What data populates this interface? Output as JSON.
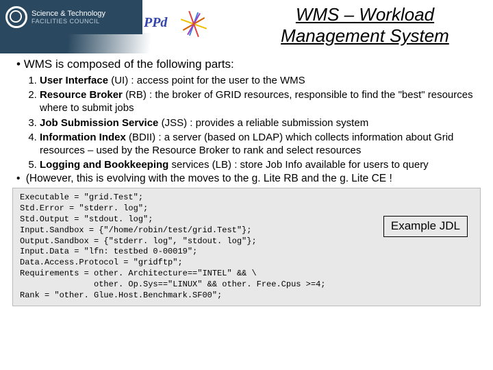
{
  "logo": {
    "line1": "Science & Technology",
    "line2": "FACILITIES COUNCIL"
  },
  "ppd_label": "PPd",
  "title": "WMS – Workload Management System",
  "intro": "WMS is composed of the following parts:",
  "parts": [
    {
      "name": "User Interface",
      "abbr": "(UI)",
      "desc": " : access point for the user to the WMS"
    },
    {
      "name": "Resource Broker",
      "abbr": "(RB)",
      "desc": " : the broker of GRID resources, responsible to find the \"best\" resources where to submit jobs"
    },
    {
      "name": "Job Submission Service",
      "abbr": "(JSS)",
      "desc": " : provides a reliable submission system"
    },
    {
      "name": "Information Index",
      "abbr": "(BDII)",
      "desc": " : a server (based on LDAP) which collects information about Grid resources – used by the Resource Broker to rank and select resources"
    },
    {
      "name": "Logging and Bookkeeping",
      "abbr": "services (LB)",
      "desc": " : store Job Info available for users to query"
    }
  ],
  "however": "(However, this is evolving with the moves to the g. Lite RB and the g. Lite CE !",
  "jdl": "Executable = \"grid.Test\";\nStd.Error = \"stderr. log\";\nStd.Output = \"stdout. log\";\nInput.Sandbox = {\"/home/robin/test/grid.Test\"};\nOutput.Sandbox = {\"stderr. log\", \"stdout. log\"};\nInput.Data = \"lfn: testbed 0-00019\";\nData.Access.Protocol = \"gridftp\";\nRequirements = other. Architecture==\"INTEL\" && \\\n               other. Op.Sys==\"LINUX\" && other. Free.Cpus >=4;\nRank = \"other. Glue.Host.Benchmark.SF00\";",
  "example_label": "Example JDL"
}
